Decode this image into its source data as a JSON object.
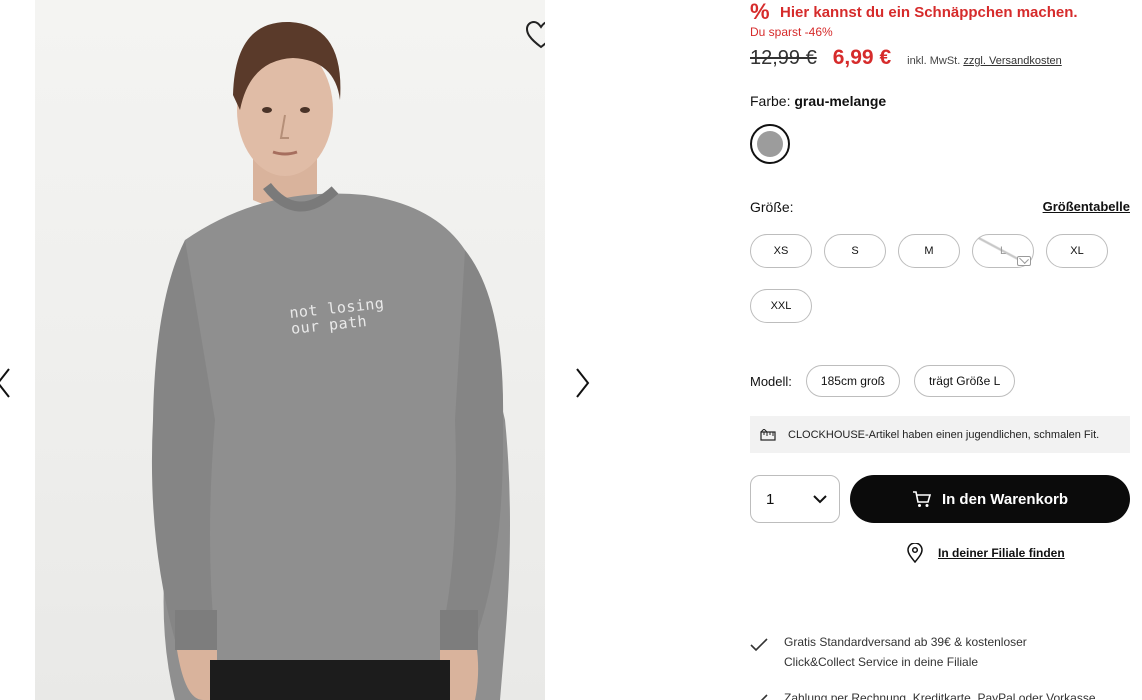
{
  "gallery": {
    "print_line1": "not losing",
    "print_line2": "our path",
    "icons": {
      "prev": "chevron-left-icon",
      "next": "chevron-right-icon",
      "wishlist": "heart-icon"
    }
  },
  "deal": {
    "icon": "%",
    "headline": "Hier kannst du ein Schnäppchen machen.",
    "savings": "Du sparst -46%"
  },
  "price": {
    "old": "12,99 €",
    "new": "6,99 €",
    "vat": "inkl. MwSt.",
    "shipping_link": "zzgl. Versandkosten"
  },
  "color": {
    "label": "Farbe:",
    "value": "grau-melange",
    "swatch_hex": "#9c9c9c"
  },
  "size": {
    "label": "Größe:",
    "chart_link": "Größentabelle",
    "options": [
      {
        "label": "XS",
        "available": true
      },
      {
        "label": "S",
        "available": true
      },
      {
        "label": "M",
        "available": true
      },
      {
        "label": "L",
        "available": false
      },
      {
        "label": "XL",
        "available": true
      },
      {
        "label": "XXL",
        "available": true
      }
    ]
  },
  "model": {
    "label": "Modell:",
    "height": "185cm groß",
    "wears": "trägt Größe L"
  },
  "notice": {
    "text": "CLOCKHOUSE-Artikel haben einen jugendlichen, schmalen Fit."
  },
  "purchase": {
    "quantity": "1",
    "cart_button": "In den Warenkorb",
    "store_link": "In deiner Filiale finden"
  },
  "benefits": [
    {
      "line1": "Gratis Standardversand ab 39€ & kostenloser",
      "line2": "Click&Collect Service in deine Filiale"
    },
    {
      "line1": "Zahlung per Rechnung, Kreditkarte, PayPal oder Vorkasse",
      "line2": ""
    }
  ],
  "colors": {
    "accent_red": "#d62b2b",
    "button_black": "#0b0b0b"
  }
}
